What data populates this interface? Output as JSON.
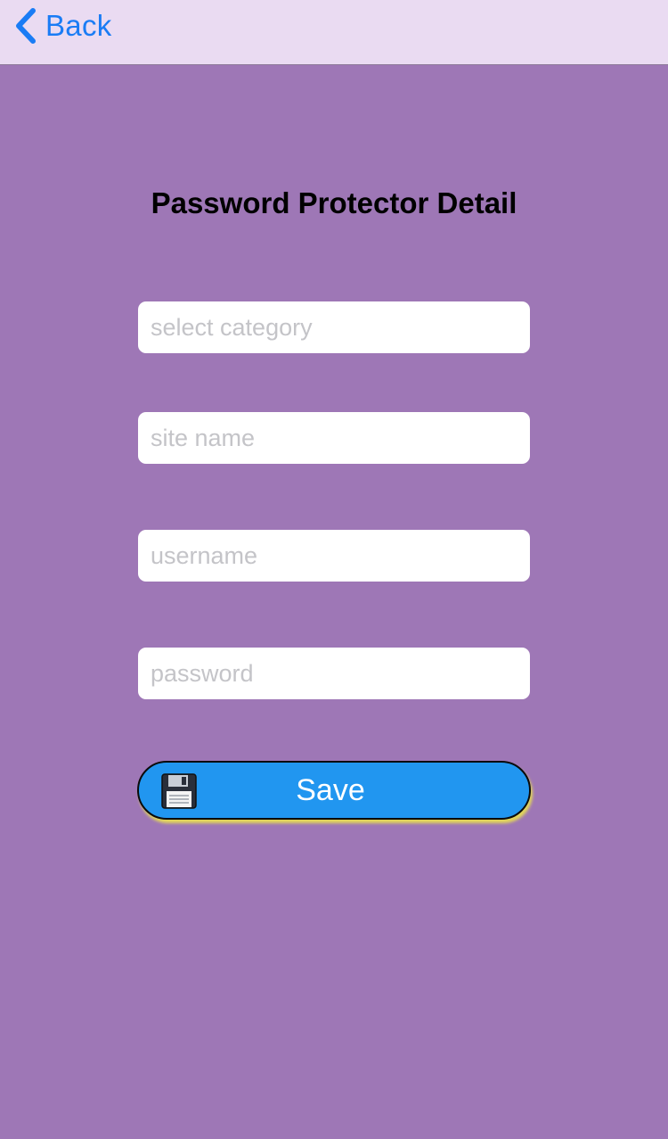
{
  "navbar": {
    "back_label": "Back"
  },
  "page": {
    "title": "Password Protector Detail"
  },
  "form": {
    "category": {
      "value": "",
      "placeholder": "select category"
    },
    "site_name": {
      "value": "",
      "placeholder": "site name"
    },
    "username": {
      "value": "",
      "placeholder": "username"
    },
    "password": {
      "value": "",
      "placeholder": "password"
    },
    "save_label": "Save",
    "save_icon": "floppy-disk-icon"
  },
  "colors": {
    "background": "#9e77b6",
    "navbar": "#eadbf2",
    "accent": "#1a7cf5",
    "save_button": "#2196f0"
  }
}
